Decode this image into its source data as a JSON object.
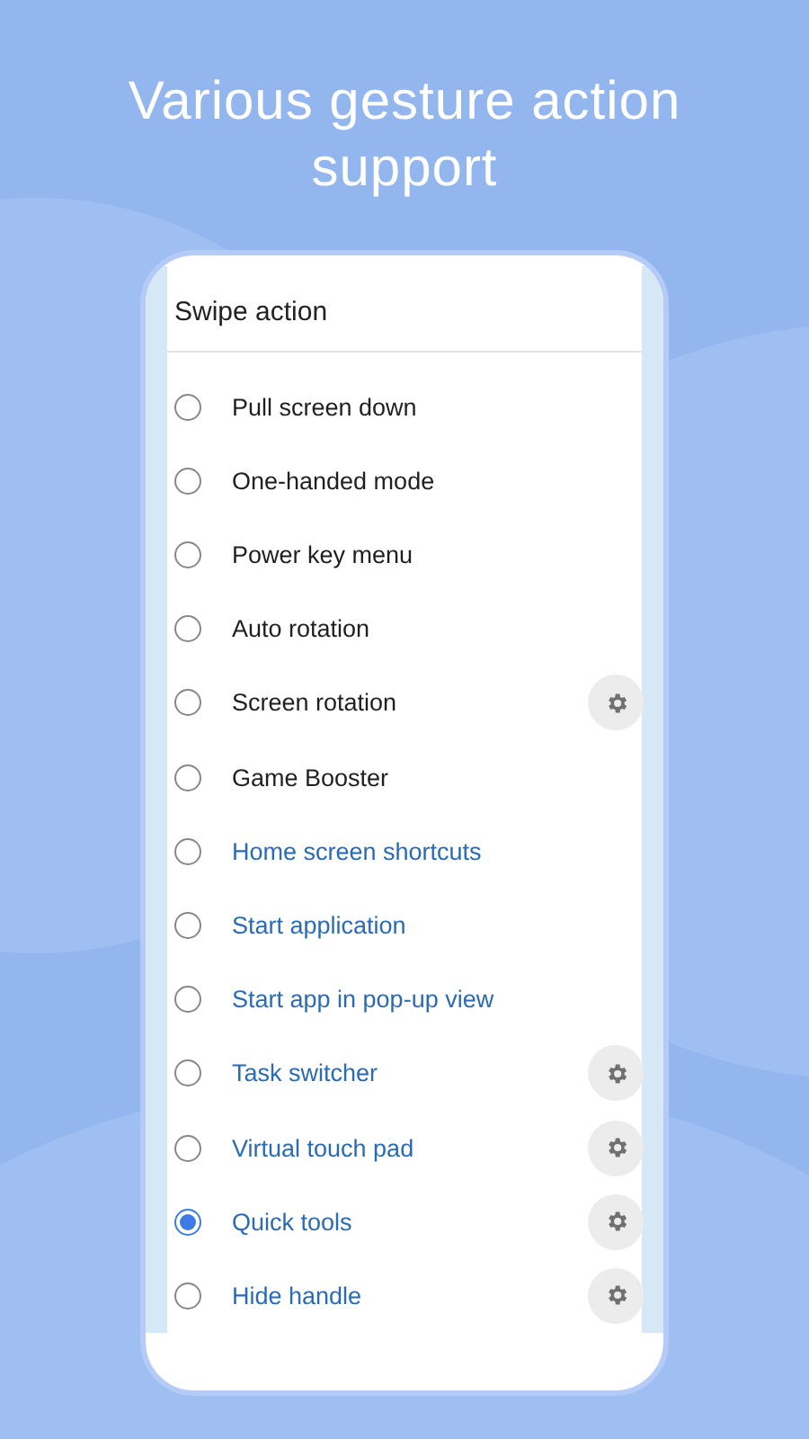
{
  "headline": "Various gesture action support",
  "screen": {
    "title": "Swipe action",
    "options": [
      {
        "label": "Pull screen down",
        "kind": "plain",
        "selected": false,
        "settings": false
      },
      {
        "label": "One-handed mode",
        "kind": "plain",
        "selected": false,
        "settings": false
      },
      {
        "label": "Power key menu",
        "kind": "plain",
        "selected": false,
        "settings": false
      },
      {
        "label": "Auto rotation",
        "kind": "plain",
        "selected": false,
        "settings": false
      },
      {
        "label": "Screen rotation",
        "kind": "plain",
        "selected": false,
        "settings": true
      },
      {
        "label": "Game Booster",
        "kind": "plain",
        "selected": false,
        "settings": false
      },
      {
        "label": "Home screen shortcuts",
        "kind": "feature",
        "selected": false,
        "settings": false
      },
      {
        "label": "Start application",
        "kind": "feature",
        "selected": false,
        "settings": false
      },
      {
        "label": "Start app in pop-up view",
        "kind": "feature",
        "selected": false,
        "settings": false
      },
      {
        "label": "Task switcher",
        "kind": "feature",
        "selected": false,
        "settings": true
      },
      {
        "label": "Virtual touch pad",
        "kind": "feature",
        "selected": false,
        "settings": true
      },
      {
        "label": "Quick tools",
        "kind": "feature",
        "selected": true,
        "settings": true
      },
      {
        "label": "Hide handle",
        "kind": "feature",
        "selected": false,
        "settings": true
      }
    ]
  }
}
